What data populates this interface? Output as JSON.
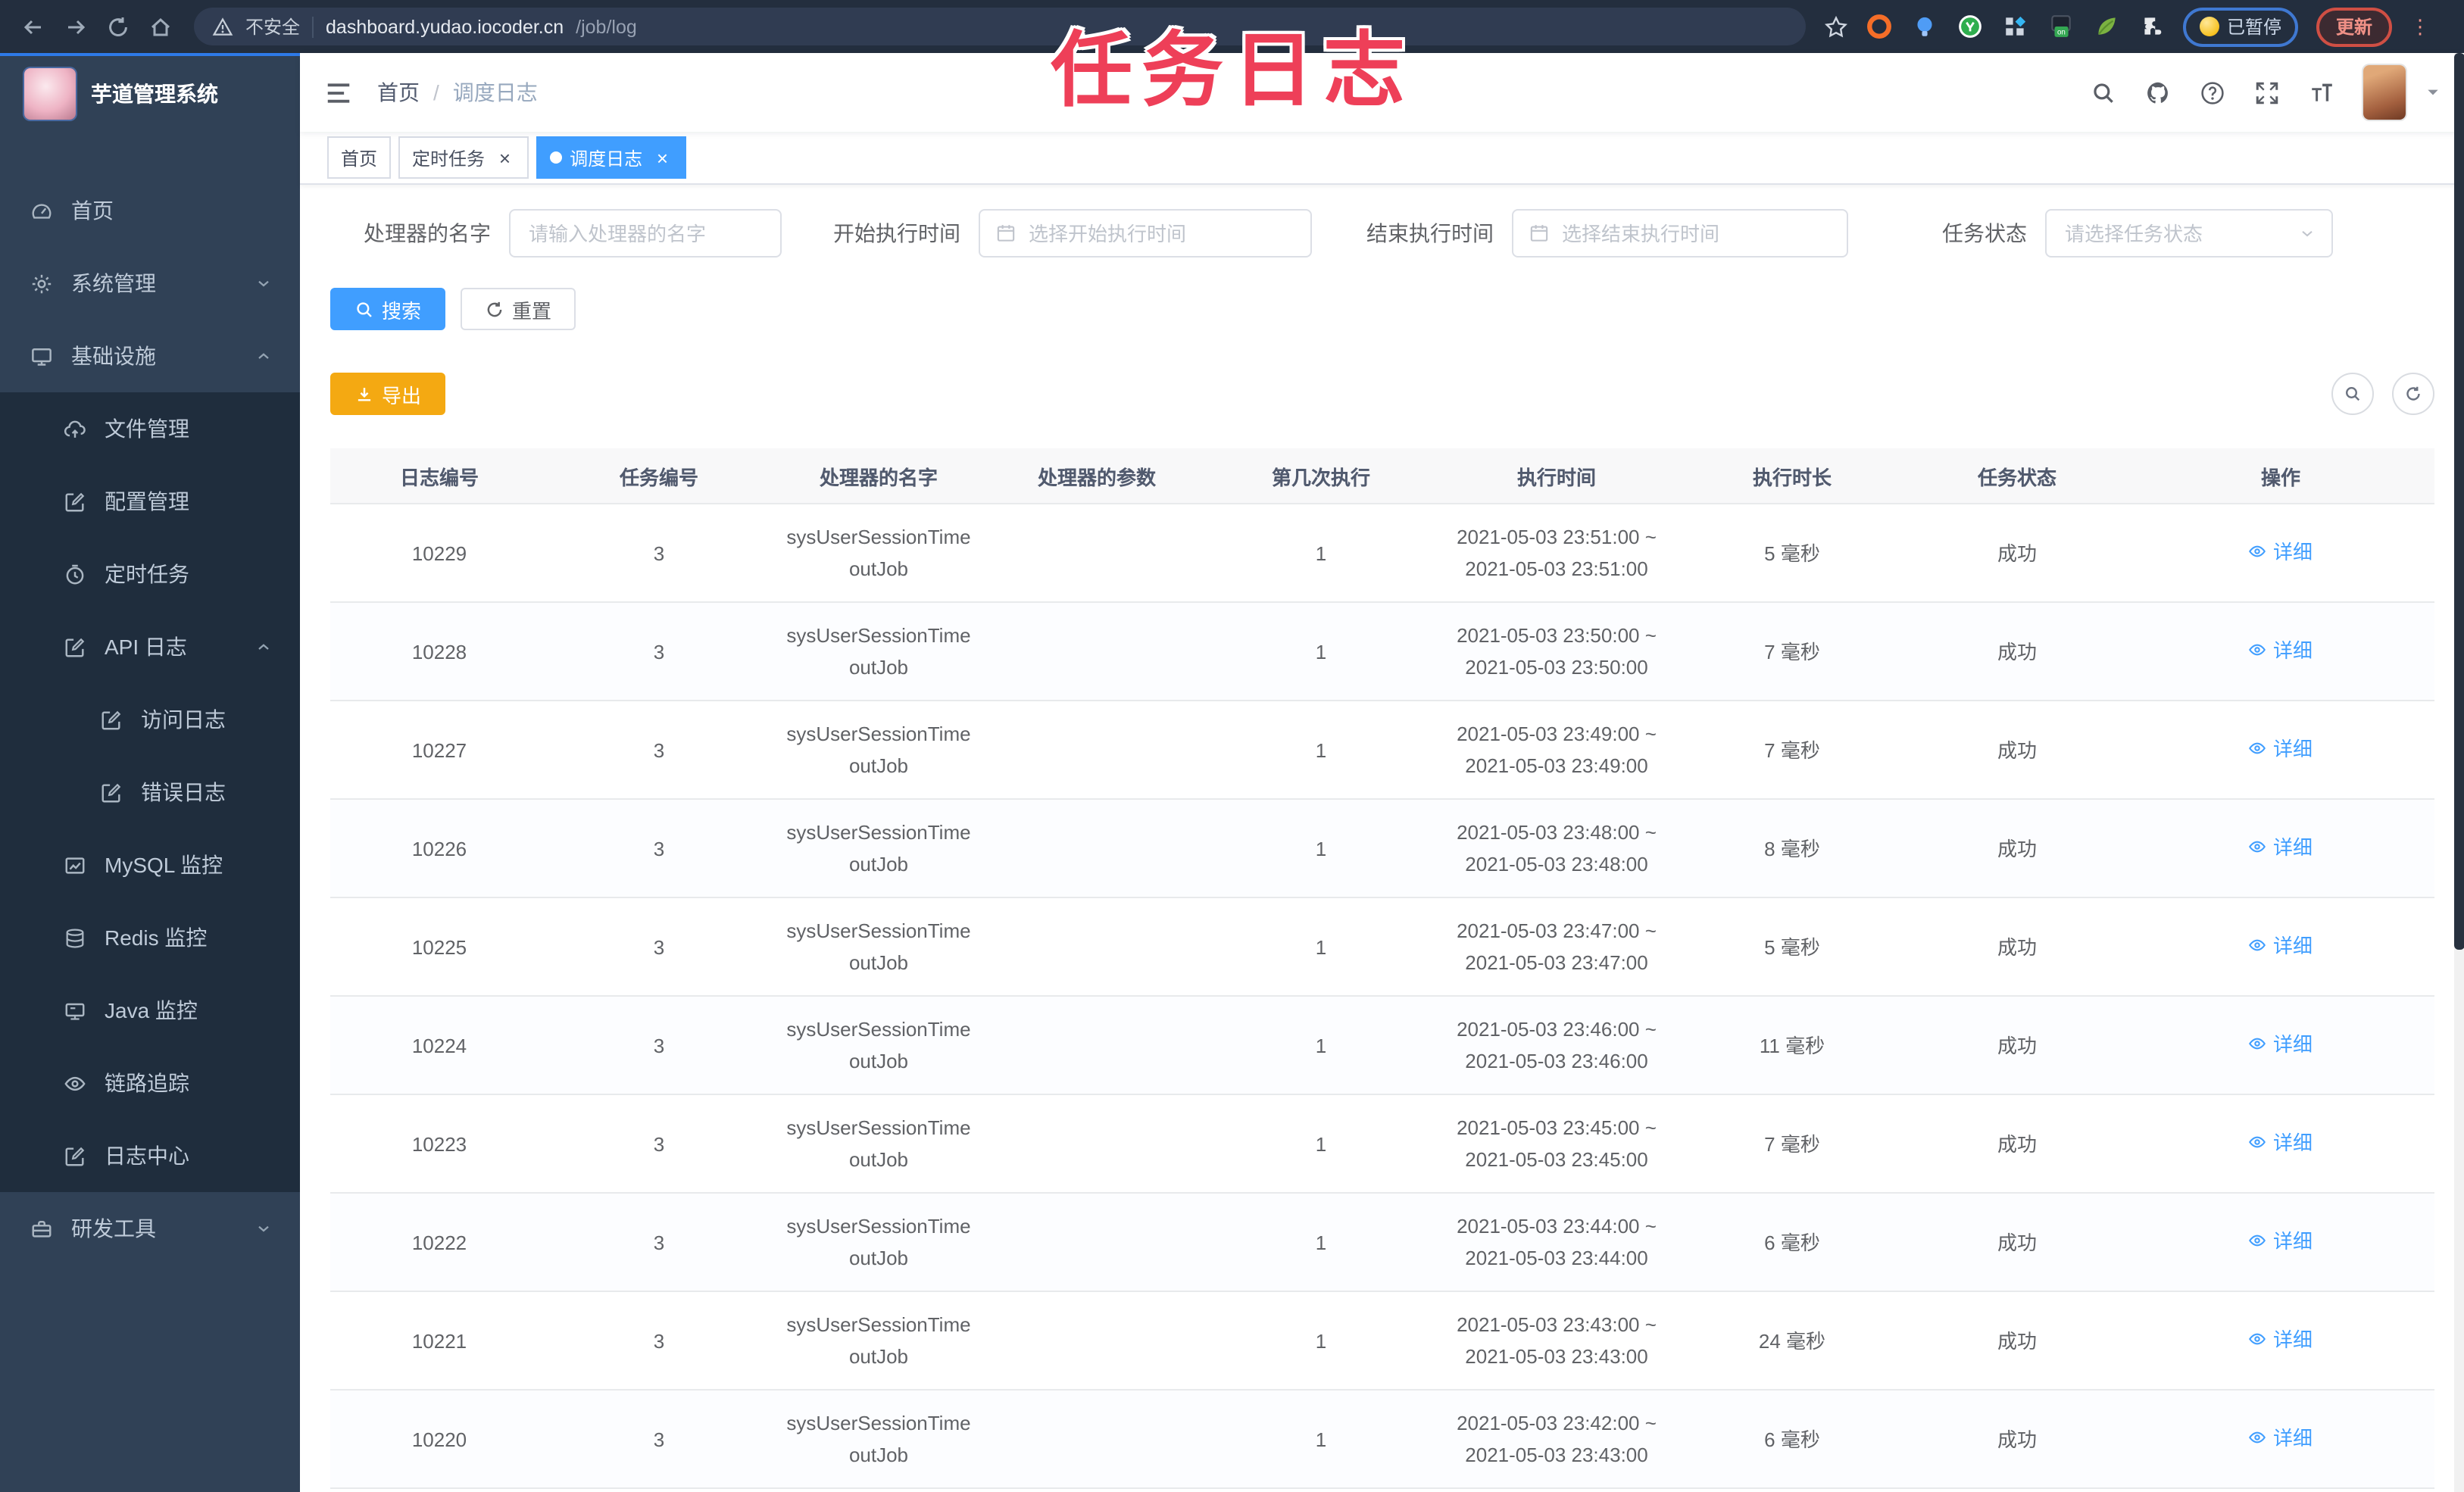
{
  "browser": {
    "security_label": "不安全",
    "host": "dashboard.yudao.iocoder.cn",
    "path": "/job/log",
    "paused_label": "已暂停",
    "update_label": "更新",
    "extensions": [
      "ublock-icon",
      "bulb-icon",
      "y-browser-icon",
      "tabs-icon",
      "onetab-icon",
      "leaf-icon",
      "puzzle-icon"
    ]
  },
  "overlay": {
    "title": "任务日志",
    "color": "#ee3f58"
  },
  "sidebar": {
    "app_title": "芋道管理系统",
    "items": [
      {
        "label": "首页",
        "icon": "dashboard-icon",
        "level": 1
      },
      {
        "label": "系统管理",
        "icon": "gear-icon",
        "level": 1,
        "arrow": "down"
      },
      {
        "label": "基础设施",
        "icon": "monitor-icon",
        "level": 1,
        "arrow": "up"
      },
      {
        "label": "文件管理",
        "icon": "cloud-upload-icon",
        "level": 2
      },
      {
        "label": "配置管理",
        "icon": "edit-icon",
        "level": 2
      },
      {
        "label": "定时任务",
        "icon": "timer-icon",
        "level": 2
      },
      {
        "label": "API 日志",
        "icon": "log-icon",
        "level": 2,
        "arrow": "up"
      },
      {
        "label": "访问日志",
        "icon": "log-icon",
        "level": 3
      },
      {
        "label": "错误日志",
        "icon": "log-icon",
        "level": 3
      },
      {
        "label": "MySQL 监控",
        "icon": "chart-icon",
        "level": 2
      },
      {
        "label": "Redis 监控",
        "icon": "database-icon",
        "level": 2
      },
      {
        "label": "Java 监控",
        "icon": "java-monitor-icon",
        "level": 2
      },
      {
        "label": "链路追踪",
        "icon": "eye-icon",
        "level": 2
      },
      {
        "label": "日志中心",
        "icon": "log-icon",
        "level": 2
      },
      {
        "label": "研发工具",
        "icon": "toolbox-icon",
        "level": 1,
        "arrow": "down"
      }
    ]
  },
  "breadcrumb": {
    "home": "首页",
    "separator": "/",
    "current": "调度日志"
  },
  "tabs": [
    {
      "label": "首页",
      "closable": false,
      "active": false
    },
    {
      "label": "定时任务",
      "closable": true,
      "active": false
    },
    {
      "label": "调度日志",
      "closable": true,
      "active": true
    }
  ],
  "filters": [
    {
      "label": "处理器的名字",
      "placeholder": "请输入处理器的名字",
      "type": "text"
    },
    {
      "label": "开始执行时间",
      "placeholder": "选择开始执行时间",
      "type": "date"
    },
    {
      "label": "结束执行时间",
      "placeholder": "选择结束执行时间",
      "type": "date"
    },
    {
      "label": "任务状态",
      "placeholder": "请选择任务状态",
      "type": "select"
    }
  ],
  "actions": {
    "search": "搜索",
    "reset": "重置",
    "export": "导出"
  },
  "table": {
    "columns": [
      "日志编号",
      "任务编号",
      "处理器的名字",
      "处理器的参数",
      "第几次执行",
      "执行时间",
      "执行时长",
      "任务状态",
      "操作"
    ],
    "detail_label": "详细",
    "rows": [
      {
        "id": "10229",
        "job_id": "3",
        "handler": "sysUserSessionTimeoutJob",
        "param": "",
        "count": "1",
        "time1": "2021-05-03 23:51:00 ~",
        "time2": "2021-05-03 23:51:00",
        "duration": "5 毫秒",
        "status": "成功"
      },
      {
        "id": "10228",
        "job_id": "3",
        "handler": "sysUserSessionTimeoutJob",
        "param": "",
        "count": "1",
        "time1": "2021-05-03 23:50:00 ~",
        "time2": "2021-05-03 23:50:00",
        "duration": "7 毫秒",
        "status": "成功"
      },
      {
        "id": "10227",
        "job_id": "3",
        "handler": "sysUserSessionTimeoutJob",
        "param": "",
        "count": "1",
        "time1": "2021-05-03 23:49:00 ~",
        "time2": "2021-05-03 23:49:00",
        "duration": "7 毫秒",
        "status": "成功"
      },
      {
        "id": "10226",
        "job_id": "3",
        "handler": "sysUserSessionTimeoutJob",
        "param": "",
        "count": "1",
        "time1": "2021-05-03 23:48:00 ~",
        "time2": "2021-05-03 23:48:00",
        "duration": "8 毫秒",
        "status": "成功"
      },
      {
        "id": "10225",
        "job_id": "3",
        "handler": "sysUserSessionTimeoutJob",
        "param": "",
        "count": "1",
        "time1": "2021-05-03 23:47:00 ~",
        "time2": "2021-05-03 23:47:00",
        "duration": "5 毫秒",
        "status": "成功"
      },
      {
        "id": "10224",
        "job_id": "3",
        "handler": "sysUserSessionTimeoutJob",
        "param": "",
        "count": "1",
        "time1": "2021-05-03 23:46:00 ~",
        "time2": "2021-05-03 23:46:00",
        "duration": "11 毫秒",
        "status": "成功"
      },
      {
        "id": "10223",
        "job_id": "3",
        "handler": "sysUserSessionTimeoutJob",
        "param": "",
        "count": "1",
        "time1": "2021-05-03 23:45:00 ~",
        "time2": "2021-05-03 23:45:00",
        "duration": "7 毫秒",
        "status": "成功"
      },
      {
        "id": "10222",
        "job_id": "3",
        "handler": "sysUserSessionTimeoutJob",
        "param": "",
        "count": "1",
        "time1": "2021-05-03 23:44:00 ~",
        "time2": "2021-05-03 23:44:00",
        "duration": "6 毫秒",
        "status": "成功"
      },
      {
        "id": "10221",
        "job_id": "3",
        "handler": "sysUserSessionTimeoutJob",
        "param": "",
        "count": "1",
        "time1": "2021-05-03 23:43:00 ~",
        "time2": "2021-05-03 23:43:00",
        "duration": "24 毫秒",
        "status": "成功"
      },
      {
        "id": "10220",
        "job_id": "3",
        "handler": "sysUserSessionTimeoutJob",
        "param": "",
        "count": "1",
        "time1": "2021-05-03 23:42:00 ~",
        "time2": "2021-05-03 23:43:00",
        "duration": "6 毫秒",
        "status": "成功"
      }
    ]
  },
  "colors": {
    "accent": "#409eff",
    "warning": "#f4a912",
    "overlay_title": "#ee3f58",
    "sidebar_bg": "#304156",
    "submenu_bg": "#1f2d3d",
    "chrome_bg": "#232e3e",
    "active_tab_bg": "#409eff"
  }
}
